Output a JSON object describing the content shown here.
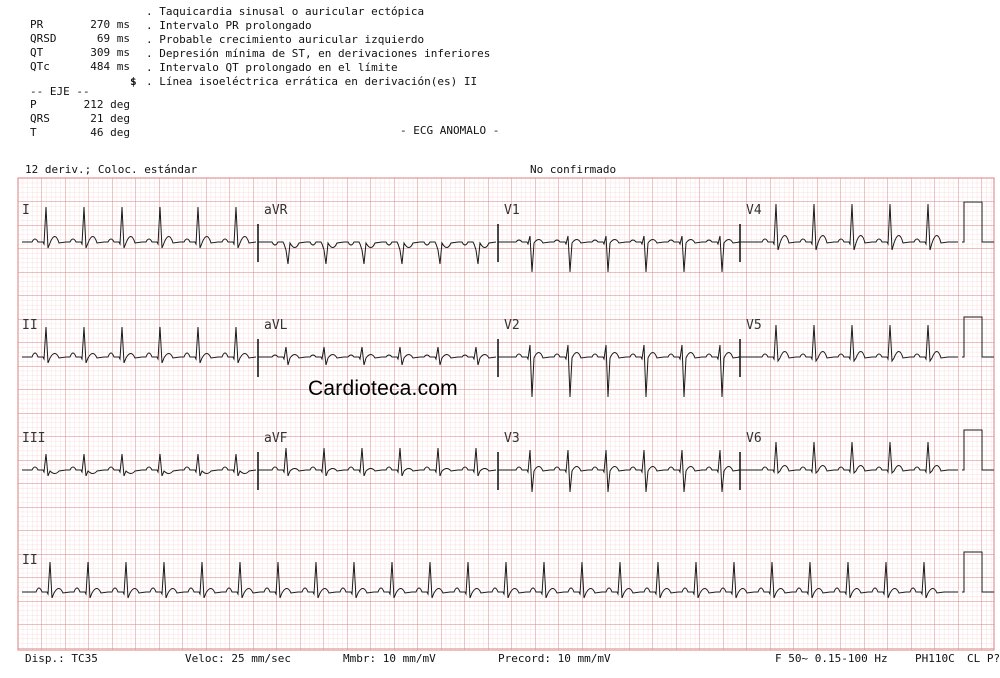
{
  "measurements": [
    {
      "label": "PR",
      "value": "270 ms"
    },
    {
      "label": "QRSD",
      "value": "69 ms"
    },
    {
      "label": "QT",
      "value": "309 ms"
    },
    {
      "label": "QTc",
      "value": "484 ms"
    }
  ],
  "axis_title": "-- EJE --",
  "axis": [
    {
      "label": "P",
      "value": "212 deg"
    },
    {
      "label": "QRS",
      "value": "21 deg"
    },
    {
      "label": "T",
      "value": "46 deg"
    }
  ],
  "interpretation": [
    {
      "marker": "",
      "text": ". Taquicardia sinusal o auricular ectópica"
    },
    {
      "marker": "",
      "text": ". Intervalo PR prolongado"
    },
    {
      "marker": "",
      "text": ". Probable crecimiento auricular izquierdo"
    },
    {
      "marker": "",
      "text": ". Depresión mínima de ST, en derivaciones inferiores"
    },
    {
      "marker": "",
      "text": ". Intervalo QT prolongado en el límite"
    },
    {
      "marker": "$",
      "text": ". Línea isoeléctrica errática en derivación(es) II"
    }
  ],
  "diagnosis": "- ECG ANOMALO -",
  "leads_info": "12 deriv.; Coloc. estándar",
  "confirm_status": "No confirmado",
  "lead_labels": [
    "I",
    "aVR",
    "V1",
    "V4",
    "II",
    "aVL",
    "V2",
    "V5",
    "III",
    "aVF",
    "V3",
    "V6",
    "II"
  ],
  "footer": {
    "display": "Disp.: TC35",
    "speed": "Veloc: 25 mm/sec",
    "limb_gain": "Mmbr: 10 mm/mV",
    "chest_gain": "Precord: 10 mm/mV",
    "filter": "F 50~ 0.15-100 Hz",
    "device": "PH110C",
    "misc": "CL P?"
  },
  "watermark": "Cardioteca.com",
  "colors": {
    "grid_minor": "#f4c2c2",
    "grid_major": "#d98282",
    "trace": "#1a1a1a"
  }
}
